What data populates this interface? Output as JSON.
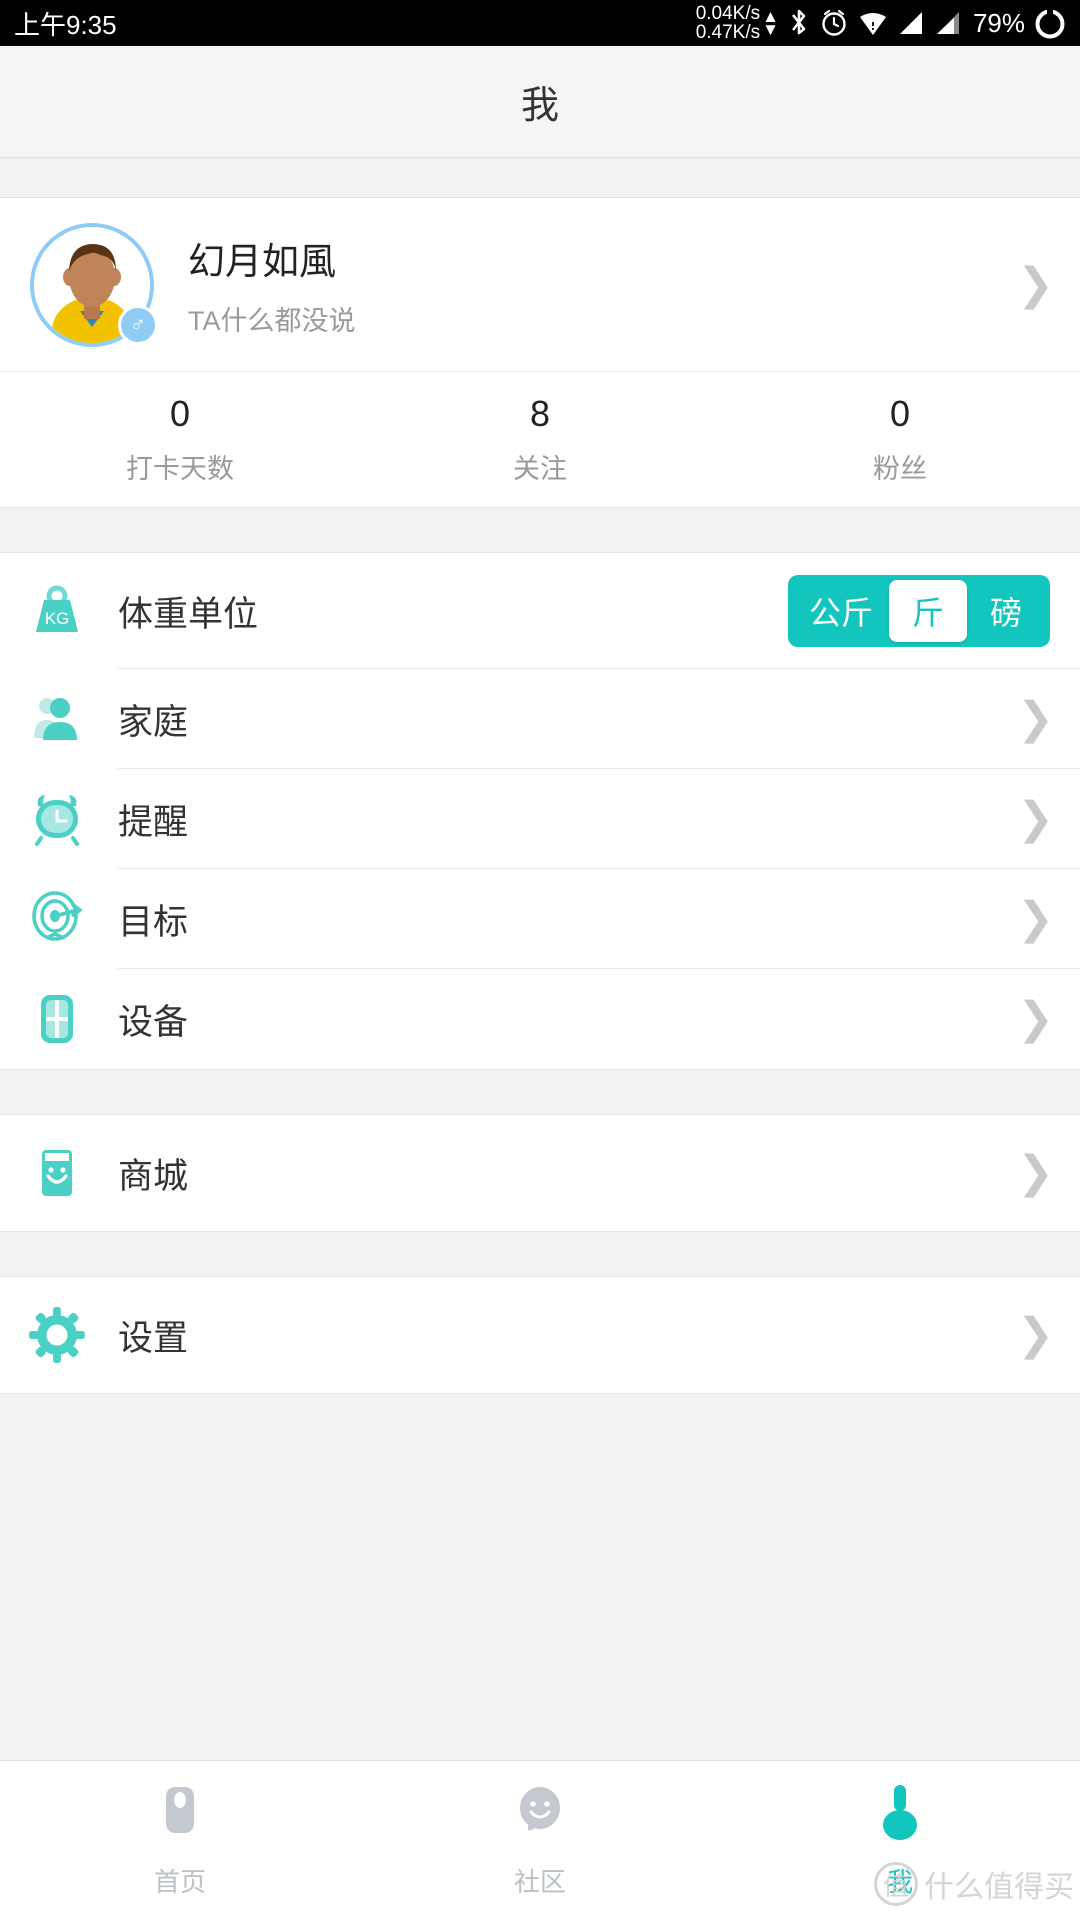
{
  "statusbar": {
    "time": "上午9:35",
    "net_up": "0.04K/s",
    "net_down": "0.47K/s",
    "up_arrow": "▲",
    "down_arrow": "▼",
    "bluetooth_icon": "bluetooth-icon",
    "alarm_icon": "alarm-icon",
    "wifi_icon": "wifi-icon",
    "signal1_icon": "signal-bars-icon",
    "signal2_icon": "signal-bars-icon",
    "battery_percent": "79%",
    "battery_icon": "battery-circle-icon"
  },
  "header": {
    "title": "我"
  },
  "profile": {
    "name": "幻月如風",
    "subtitle": "TA什么都没说",
    "gender_symbol": "♂",
    "chevron": "❯"
  },
  "stats": [
    {
      "value": "0",
      "label": "打卡天数"
    },
    {
      "value": "8",
      "label": "关注"
    },
    {
      "value": "0",
      "label": "粉丝"
    }
  ],
  "weight_unit": {
    "label": "体重单位",
    "icon": "kg-weight-icon",
    "icon_text": "KG",
    "options": [
      {
        "label": "公斤",
        "selected": false
      },
      {
        "label": "斤",
        "selected": true
      },
      {
        "label": "磅",
        "selected": false
      }
    ]
  },
  "menu_group_1": [
    {
      "label": "家庭",
      "icon": "family-people-icon",
      "chevron": "❯"
    },
    {
      "label": "提醒",
      "icon": "alarm-clock-icon",
      "chevron": "❯"
    },
    {
      "label": "目标",
      "icon": "target-icon",
      "chevron": "❯"
    },
    {
      "label": "设备",
      "icon": "devices-grid-icon",
      "chevron": "❯"
    }
  ],
  "menu_group_2": [
    {
      "label": "商城",
      "icon": "shopping-bag-icon",
      "chevron": "❯"
    }
  ],
  "menu_group_3": [
    {
      "label": "设置",
      "icon": "gear-icon",
      "chevron": "❯"
    }
  ],
  "bottom_nav": [
    {
      "label": "首页",
      "icon": "home-icon",
      "active": false
    },
    {
      "label": "社区",
      "icon": "community-chat-icon",
      "active": false
    },
    {
      "label": "我",
      "icon": "person-icon",
      "active": true
    }
  ],
  "watermark": {
    "text": "什么值得买",
    "mark": "值"
  },
  "colors": {
    "accent": "#12c6bd",
    "accent_light": "#7fdcd7",
    "avatar_ring": "#8ecbf5",
    "nav_inactive": "#b9c0c6",
    "page_bg": "#f2f2f2"
  }
}
